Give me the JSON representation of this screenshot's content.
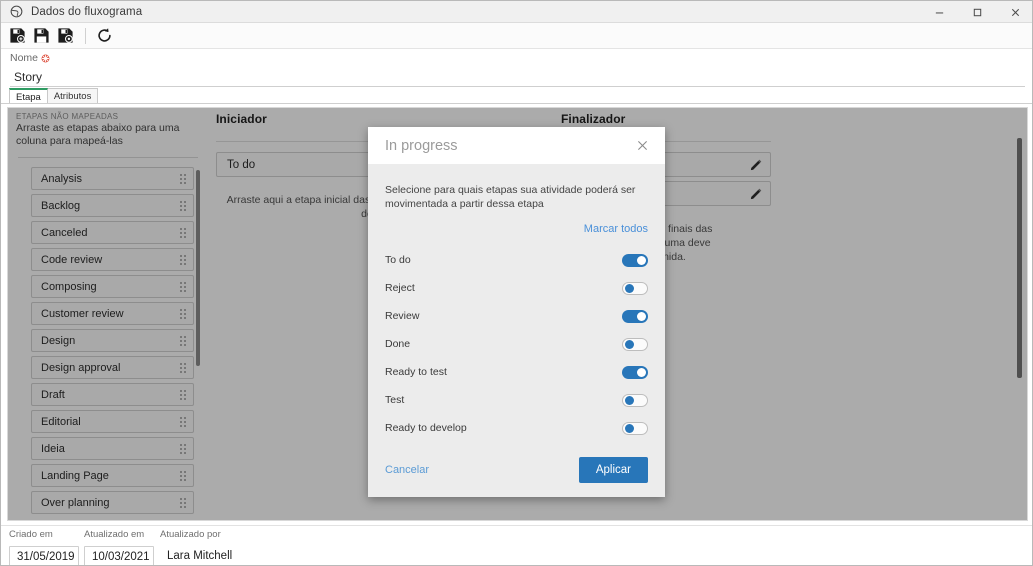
{
  "window": {
    "title": "Dados do fluxograma",
    "icon": "app-globe-icon",
    "controls": {
      "minimize": "–",
      "maximize": "☐",
      "close": "✕"
    }
  },
  "toolbar": {
    "buttons": [
      {
        "name": "save-new-icon",
        "tip": "Salvar novo"
      },
      {
        "name": "save-icon",
        "tip": "Salvar"
      },
      {
        "name": "save-as-icon",
        "tip": "Salvar como"
      },
      {
        "name": "refresh-icon",
        "tip": "Atualizar"
      }
    ]
  },
  "name_field": {
    "label": "Nome",
    "required_marker": "❋",
    "value": "Story",
    "placeholder": "Nome"
  },
  "tabs": [
    {
      "label": "Etapa",
      "active": true
    },
    {
      "label": "Atributos",
      "active": false
    }
  ],
  "board": {
    "unmapped": {
      "kicker": "ETAPAS NÃO MAPEADAS",
      "subtitle": "Arraste as etapas abaixo para uma coluna para mapeá-las",
      "items": [
        "Analysis",
        "Backlog",
        "Canceled",
        "Code review",
        "Composing",
        "Customer review",
        "Design",
        "Design approval",
        "Draft",
        "Editorial",
        "Ideia",
        "Landing Page",
        "Over planning"
      ]
    },
    "starter": {
      "title": "Iniciador",
      "slots": [
        "To do"
      ],
      "hint": "Arraste aqui a etapa inicial das atividades. Somente uma pode ser definida."
    },
    "final": {
      "title": "Finalizador",
      "slots": [
        "",
        ""
      ],
      "hint_line1": "as etapas finais das",
      "hint_line2": "o menos uma deve",
      "hint_line3": "definida."
    }
  },
  "modal": {
    "title": "In progress",
    "close_label": "✕",
    "description": "Selecione para quais etapas sua atividade poderá ser movimentada a partir dessa etapa",
    "check_all_label": "Marcar todos",
    "toggles": [
      {
        "label": "To do",
        "on": true
      },
      {
        "label": "Reject",
        "on": false
      },
      {
        "label": "Review",
        "on": true
      },
      {
        "label": "Done",
        "on": false
      },
      {
        "label": "Ready to test",
        "on": true
      },
      {
        "label": "Test",
        "on": false
      },
      {
        "label": "Ready to develop",
        "on": false
      }
    ],
    "cancel_label": "Cancelar",
    "apply_label": "Aplicar"
  },
  "footer": {
    "created_label": "Criado em",
    "created_value": "31/05/2019",
    "updated_label": "Atualizado em",
    "updated_value": "10/03/2021",
    "updated_by_label": "Atualizado por",
    "updated_by_value": "Lara Mitchell"
  },
  "colors": {
    "accent_blue": "#2876b9",
    "link_blue": "#4a90d9",
    "tab_active_green": "#2e9b62",
    "required_red": "#e05a4a"
  }
}
